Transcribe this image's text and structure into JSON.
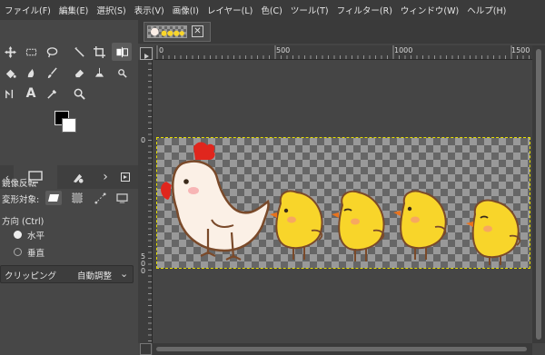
{
  "menu": [
    "ファイル(F)",
    "編集(E)",
    "選択(S)",
    "表示(V)",
    "画像(I)",
    "レイヤー(L)",
    "色(C)",
    "ツール(T)",
    "フィルター(R)",
    "ウィンドウ(W)",
    "ヘルプ(H)"
  ],
  "tool_options": {
    "title": "鏡像反転",
    "transform_label": "変形対象:",
    "direction_label": "方向 (Ctrl)",
    "horizontal": "水平",
    "vertical": "垂直",
    "clipping_label": "クリッピング",
    "clipping_value": "自動調整"
  },
  "ruler_h": [
    "0",
    "500",
    "1000",
    "1500"
  ],
  "ruler_v": [
    "0",
    "5",
    "0",
    "0"
  ],
  "colors": {
    "fg": "#000000",
    "bg": "#ffffff",
    "selection": "#e8e000"
  }
}
